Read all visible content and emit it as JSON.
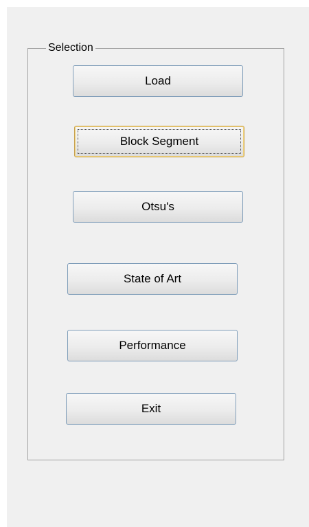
{
  "selection_panel": {
    "title": "Selection",
    "buttons": [
      {
        "label": "Load"
      },
      {
        "label": "Block Segment",
        "focused": true
      },
      {
        "label": "Otsu's"
      },
      {
        "label": "State of Art"
      },
      {
        "label": "Performance"
      },
      {
        "label": "Exit"
      }
    ]
  },
  "colors": {
    "window_background": "#f0f0f0",
    "button_border": "#7f9db9",
    "focused_button_border": "#c8a250"
  }
}
